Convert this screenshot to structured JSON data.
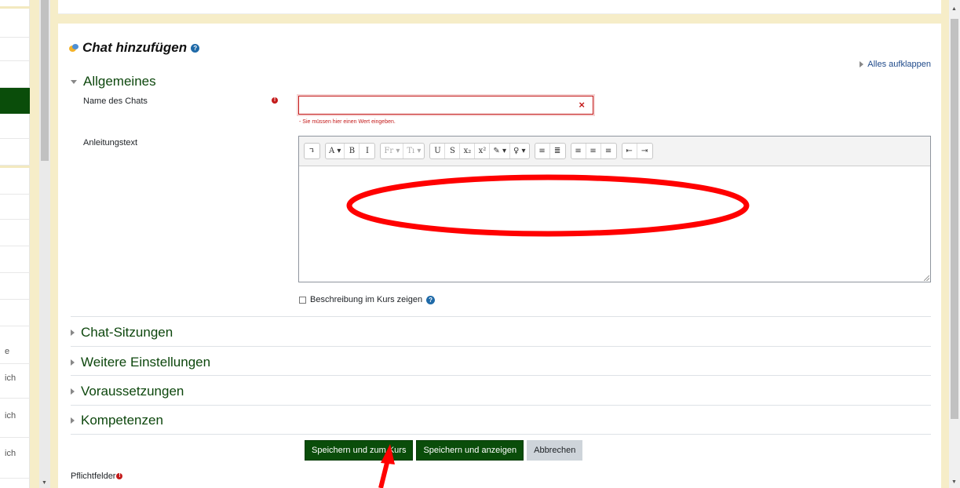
{
  "left_nav": {
    "items": [
      "e",
      "ich",
      "ich",
      "ich"
    ]
  },
  "header": {
    "title": "Chat hinzufügen",
    "help_glyph": "?",
    "expand_all": "Alles aufklappen"
  },
  "sections": {
    "general": "Allgemeines",
    "chat_sessions": "Chat-Sitzungen",
    "more_settings": "Weitere Einstellungen",
    "prerequisites": "Voraussetzungen",
    "competencies": "Kompetenzen"
  },
  "form": {
    "name_label": "Name des Chats",
    "name_value": "",
    "name_error": "- Sie müssen hier einen Wert eingeben.",
    "required_glyph": "!",
    "clear_glyph": "×",
    "description_label": "Anleitungstext",
    "show_description_label": "Beschreibung im Kurs zeigen"
  },
  "toolbar": {
    "groups": [
      [
        "↴"
      ],
      [
        "A ▾",
        "B",
        "I"
      ],
      [
        "Fr ▾",
        "Tı ▾"
      ],
      [
        "U",
        "S",
        "x₂",
        "x²",
        "✎ ▾",
        "♀ ▾"
      ],
      [
        "≡",
        "≣"
      ],
      [
        "≡",
        "≡",
        "≡"
      ],
      [
        "⇤",
        "⇥"
      ]
    ]
  },
  "buttons": {
    "save_return": "Speichern und zum Kurs",
    "save_display": "Speichern und anzeigen",
    "cancel": "Abbrechen"
  },
  "footer": {
    "required_fields": "Pflichtfelder"
  },
  "colors": {
    "brand_green": "#0a4d0a",
    "error_red": "#c41b1b",
    "annotation_red": "#ff0000",
    "cream": "#f6edc8"
  }
}
